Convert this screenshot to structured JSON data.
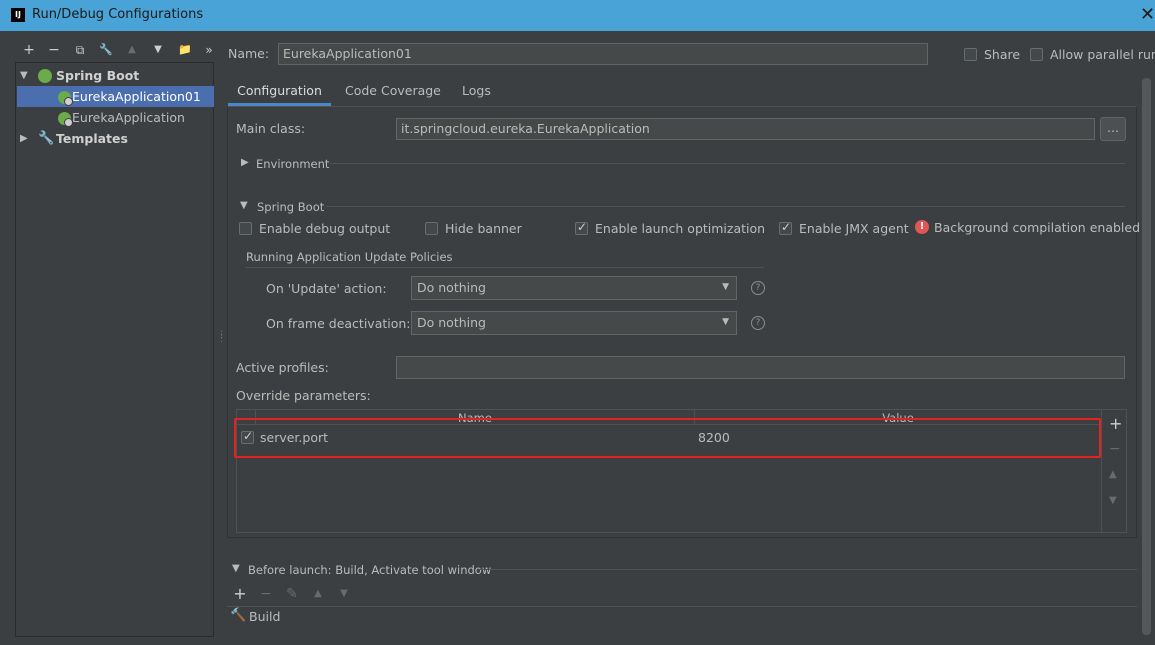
{
  "window": {
    "title": "Run/Debug Configurations",
    "app_icon": "IJ",
    "close": "✕"
  },
  "left_toolbar": [
    "+",
    "−",
    "⧉",
    "🔧",
    "▲",
    "▼",
    "📁",
    "»"
  ],
  "tree": {
    "spring_boot": "Spring Boot",
    "items": [
      "EurekaApplication01",
      "EurekaApplication"
    ],
    "templates": "Templates"
  },
  "name_row": {
    "label": "Name:",
    "value": "EurekaApplication01"
  },
  "share": {
    "label": "Share",
    "checked": false
  },
  "allow_parallel": {
    "label": "Allow parallel run",
    "checked": false
  },
  "tabs": [
    "Configuration",
    "Code Coverage",
    "Logs"
  ],
  "main_class": {
    "label": "Main class:",
    "value": "it.springcloud.eureka.EurekaApplication",
    "button": "..."
  },
  "environment": {
    "label": "Environment"
  },
  "spring_boot_section": {
    "label": "Spring Boot",
    "enable_debug_output": "Enable debug output",
    "hide_banner": "Hide banner",
    "enable_launch_optimization": "Enable launch optimization",
    "enable_jmx_agent": "Enable JMX agent",
    "background_compilation": "Background compilation enabled"
  },
  "update_policies": {
    "title": "Running Application Update Policies",
    "on_update_label": "On 'Update' action:",
    "on_update_value": "Do nothing",
    "on_frame_label": "On frame deactivation:",
    "on_frame_value": "Do nothing"
  },
  "active_profiles": {
    "label": "Active profiles:",
    "value": ""
  },
  "override_params": {
    "label": "Override parameters:",
    "columns": [
      "Name",
      "Value"
    ],
    "rows": [
      {
        "checked": true,
        "name": "server.port",
        "value": "8200"
      }
    ],
    "side_buttons": [
      "+",
      "−",
      "▲",
      "▼"
    ]
  },
  "before_launch": {
    "label": "Before launch: Build, Activate tool window",
    "toolbar": [
      "+",
      "−",
      "✎",
      "▲",
      "▼"
    ],
    "items": [
      "Build"
    ]
  },
  "colors": {
    "accent": "#4a88c7",
    "selection": "#4b6eaf",
    "highlight": "#e52222",
    "titlebar": "#4aa3d6"
  }
}
